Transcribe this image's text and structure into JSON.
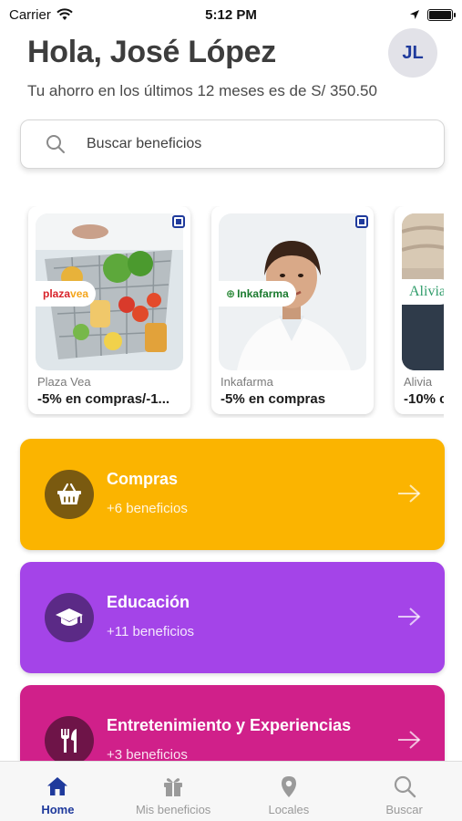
{
  "status_bar": {
    "carrier": "Carrier",
    "time": "5:12 PM"
  },
  "header": {
    "greeting": "Hola, José López",
    "avatar_initials": "JL",
    "savings_text": "Tu ahorro en los últimos 12 meses es de S/ 350.50"
  },
  "search": {
    "placeholder": "Buscar beneficios"
  },
  "carousel": {
    "cards": [
      {
        "store": "Plaza Vea",
        "offer": "-5%  en compras/-1...",
        "logo": "plazavea"
      },
      {
        "store": "Inkafarma",
        "offer": "-5% en compras",
        "logo": "Inkafarma"
      },
      {
        "store": "Alivia",
        "offer": "-10% c",
        "logo": "Alivia"
      }
    ]
  },
  "categories": [
    {
      "title": "Compras",
      "count": "+6 beneficios",
      "icon": "basket-icon",
      "color": "#FBB400",
      "circle_color": "#7a5a10"
    },
    {
      "title": "Educación",
      "count": "+11 beneficios",
      "icon": "graduation-cap-icon",
      "color": "#A444E8",
      "circle_color": "#5b2a86"
    },
    {
      "title": "Entretenimiento y Experiencias",
      "count": "+3 beneficios",
      "icon": "fork-knife-icon",
      "color": "#D0208A",
      "circle_color": "#6e1448"
    }
  ],
  "tabbar": {
    "tabs": [
      {
        "label": "Home",
        "icon": "home-icon",
        "active": true
      },
      {
        "label": "Mis beneficios",
        "icon": "gift-icon",
        "active": false
      },
      {
        "label": "Locales",
        "icon": "location-pin-icon",
        "active": false
      },
      {
        "label": "Buscar",
        "icon": "search-icon",
        "active": false
      }
    ]
  },
  "colors": {
    "brand_blue": "#1F3A9C",
    "inactive_gray": "#9A9A9A"
  }
}
